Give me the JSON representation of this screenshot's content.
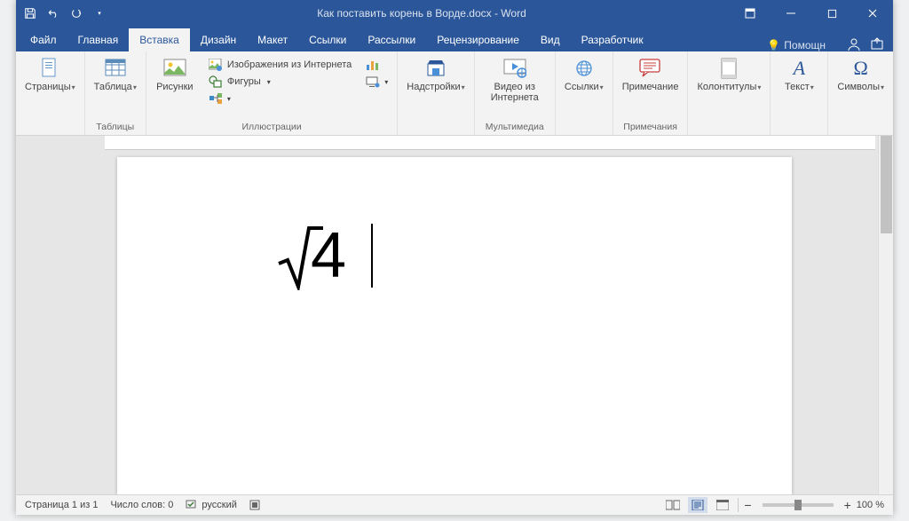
{
  "title": "Как поставить корень в Ворде.docx - Word",
  "tabs": {
    "file": "Файл",
    "home": "Главная",
    "insert": "Вставка",
    "design": "Дизайн",
    "layout": "Макет",
    "references": "Ссылки",
    "mailings": "Рассылки",
    "review": "Рецензирование",
    "view": "Вид",
    "developer": "Разработчик",
    "tell_me": "Помощн"
  },
  "ribbon": {
    "pages": {
      "label": "Страницы",
      "btn": "Страницы"
    },
    "tables": {
      "label": "Таблицы",
      "btn": "Таблица"
    },
    "illustrations": {
      "label": "Иллюстрации",
      "pictures": "Рисунки",
      "online_pic": "Изображения из Интернета",
      "shapes": "Фигуры"
    },
    "addins": {
      "label": "",
      "btn": "Надстройки"
    },
    "media": {
      "label": "Мультимедиа",
      "btn": "Видео из Интернета"
    },
    "links": {
      "label": "",
      "btn": "Ссылки"
    },
    "comments": {
      "label": "Примечания",
      "btn": "Примечание"
    },
    "header_footer": {
      "label": "",
      "btn": "Колонтитулы"
    },
    "text": {
      "label": "",
      "btn": "Текст"
    },
    "symbols": {
      "label": "",
      "btn": "Символы"
    }
  },
  "document": {
    "equation_value": "4"
  },
  "status": {
    "page": "Страница 1 из 1",
    "words": "Число слов: 0",
    "language": "русский",
    "zoom_minus": "−",
    "zoom_plus": "+",
    "zoom": "100 %"
  }
}
